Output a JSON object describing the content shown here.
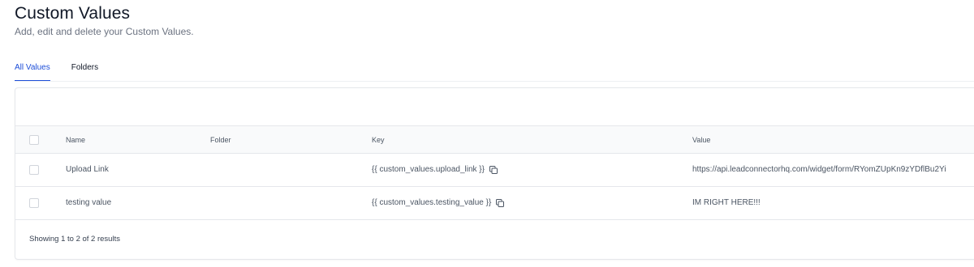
{
  "header": {
    "title": "Custom Values",
    "subtitle": "Add, edit and delete your Custom Values."
  },
  "tabs": [
    {
      "label": "All Values",
      "active": true
    },
    {
      "label": "Folders",
      "active": false
    }
  ],
  "table": {
    "columns": {
      "name": "Name",
      "folder": "Folder",
      "key": "Key",
      "value": "Value"
    },
    "rows": [
      {
        "name": "Upload Link",
        "folder": "",
        "key": "{{ custom_values.upload_link }}",
        "value": "https://api.leadconnectorhq.com/widget/form/RYomZUpKn9zYDflBu2Yi"
      },
      {
        "name": "testing value",
        "folder": "",
        "key": "{{ custom_values.testing_value }}",
        "value": "IM RIGHT HERE!!!"
      }
    ],
    "footer": "Showing 1 to 2 of 2 results"
  },
  "colors": {
    "accent": "#1d4ed8",
    "border": "#e5e7eb",
    "header_bg": "#f9fafb"
  },
  "icons": {
    "copy": "copy-icon",
    "checkbox": "checkbox"
  }
}
